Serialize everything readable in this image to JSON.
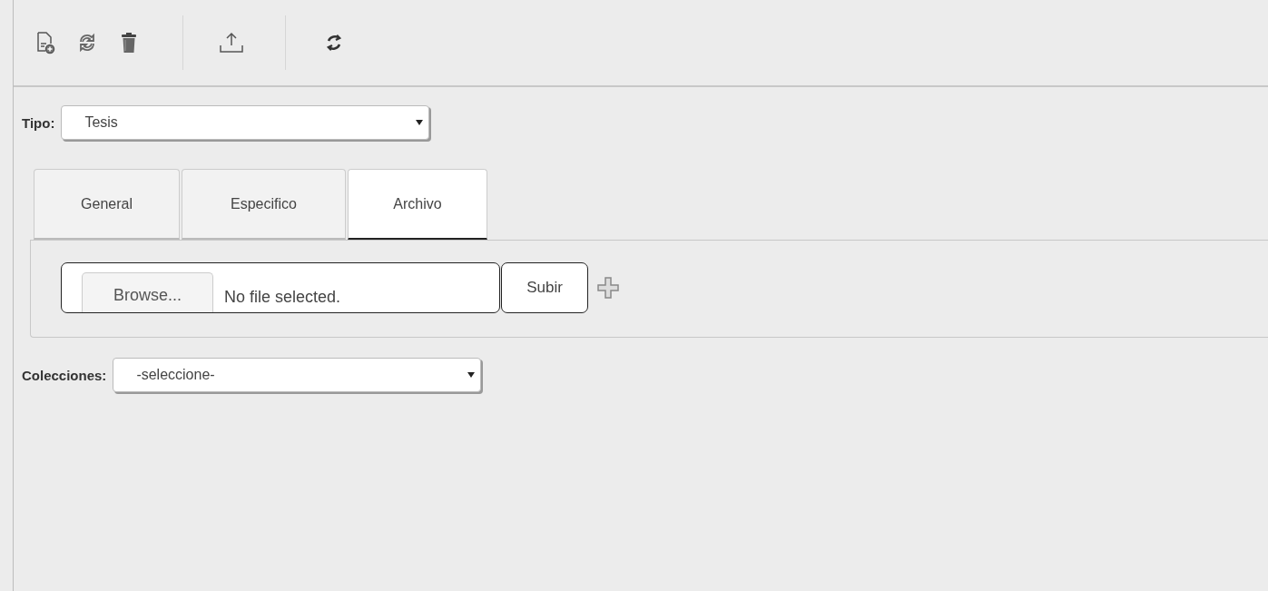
{
  "tipo": {
    "label": "Tipo:",
    "value": "Tesis"
  },
  "tabs": [
    {
      "label": "General",
      "selected": false
    },
    {
      "label": "Especifico",
      "selected": false
    },
    {
      "label": "Archivo",
      "selected": true
    }
  ],
  "file_upload": {
    "browse_button": "Browse...",
    "status": "No file selected.",
    "upload_button": "Subir"
  },
  "colecciones": {
    "label": "Colecciones:",
    "value": "-seleccione-"
  }
}
